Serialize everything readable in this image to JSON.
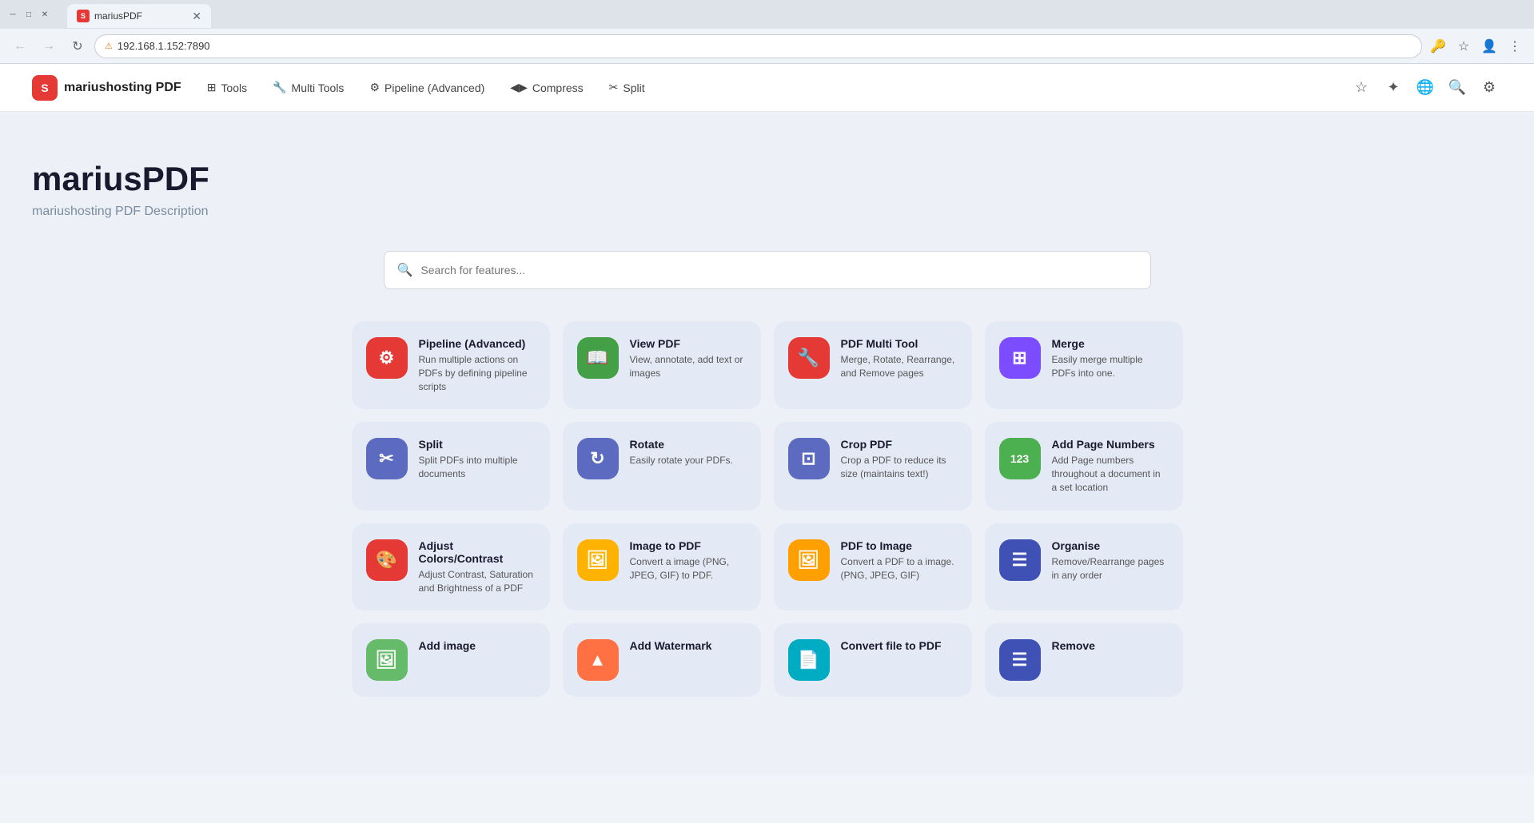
{
  "browser": {
    "tab_title": "mariusPDF",
    "tab_favicon": "S",
    "address": "192.168.1.152:7890",
    "security_label": "Not secure",
    "back_disabled": true,
    "forward_disabled": true
  },
  "nav": {
    "logo_letter": "S",
    "app_name": "mariushosting PDF",
    "links": [
      {
        "label": "Tools",
        "icon": "⊞"
      },
      {
        "label": "Multi Tools",
        "icon": "🔧"
      },
      {
        "label": "Pipeline (Advanced)",
        "icon": "⚙"
      },
      {
        "label": "Compress",
        "icon": "◀▶"
      },
      {
        "label": "Split",
        "icon": "✂"
      }
    ]
  },
  "hero": {
    "title": "mariusPDF",
    "subtitle": "mariushosting PDF Description"
  },
  "search": {
    "placeholder": "Search for features..."
  },
  "cards": [
    {
      "title": "Pipeline (Advanced)",
      "desc": "Run multiple actions on PDFs by defining pipeline scripts",
      "icon": "⚙",
      "color": "bg-red"
    },
    {
      "title": "View PDF",
      "desc": "View, annotate, add text or images",
      "icon": "📖",
      "color": "bg-green"
    },
    {
      "title": "PDF Multi Tool",
      "desc": "Merge, Rotate, Rearrange, and Remove pages",
      "icon": "🔧",
      "color": "bg-pink-red"
    },
    {
      "title": "Merge",
      "desc": "Easily merge multiple PDFs into one.",
      "icon": "⊞",
      "color": "bg-purple"
    },
    {
      "title": "Split",
      "desc": "Split PDFs into multiple documents",
      "icon": "✂",
      "color": "bg-blue-purple"
    },
    {
      "title": "Rotate",
      "desc": "Easily rotate your PDFs.",
      "icon": "↻",
      "color": "bg-blue-purple"
    },
    {
      "title": "Crop PDF",
      "desc": "Crop a PDF to reduce its size (maintains text!)",
      "icon": "⊡",
      "color": "bg-blue-purple"
    },
    {
      "title": "Add Page Numbers",
      "desc": "Add Page numbers throughout a document in a set location",
      "icon": "123",
      "color": "bg-green2"
    },
    {
      "title": "Adjust Colors/Contrast",
      "desc": "Adjust Contrast, Saturation and Brightness of a PDF",
      "icon": "🎨",
      "color": "bg-red"
    },
    {
      "title": "Image to PDF",
      "desc": "Convert a image (PNG, JPEG, GIF) to PDF.",
      "icon": "🖼",
      "color": "bg-amber"
    },
    {
      "title": "PDF to Image",
      "desc": "Convert a PDF to a image. (PNG, JPEG, GIF)",
      "icon": "🖼",
      "color": "bg-amber2"
    },
    {
      "title": "Organise",
      "desc": "Remove/Rearrange pages in any order",
      "icon": "☰",
      "color": "bg-indigo"
    },
    {
      "title": "Add image",
      "desc": "",
      "icon": "🖼",
      "color": "bg-lightgreen"
    },
    {
      "title": "Add Watermark",
      "desc": "",
      "icon": "▲",
      "color": "bg-deep-orange"
    },
    {
      "title": "Convert file to PDF",
      "desc": "",
      "icon": "📄",
      "color": "bg-cyan"
    },
    {
      "title": "Remove",
      "desc": "",
      "icon": "☰",
      "color": "bg-indigo"
    }
  ]
}
